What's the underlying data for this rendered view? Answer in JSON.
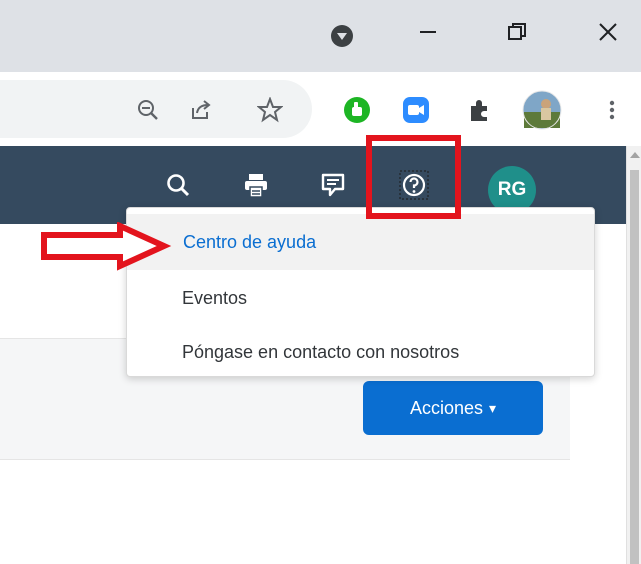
{
  "browser": {
    "window_controls": {
      "minimize_glyph": "—",
      "restore_glyph": "❐",
      "close_glyph": "✕"
    },
    "toolbar": {
      "zoom_icon": "zoom-out-icon",
      "share_icon": "share-icon",
      "bookmark_icon": "star-icon",
      "ext_1": "green-thumb-extension-icon",
      "ext_2": "zoom-extension-icon",
      "extensions_icon": "puzzle-icon",
      "profile": "profile-photo",
      "menu_icon": "kebab-menu-icon"
    }
  },
  "app_header": {
    "icons": [
      "search-icon",
      "print-icon",
      "feedback-icon",
      "help-icon"
    ],
    "avatar_initials": "RG",
    "header_color": "#354a5f"
  },
  "help_menu": {
    "items": [
      {
        "label": "Centro de ayuda",
        "highlighted": true
      },
      {
        "label": "Eventos",
        "highlighted": false
      },
      {
        "label": "Póngase en contacto con nosotros",
        "highlighted": false
      }
    ]
  },
  "page": {
    "actions_button": "Acciones",
    "actions_caret": "▾",
    "accent_color": "#0a6ed1"
  },
  "annotations": {
    "highlight_color": "#e3141d"
  }
}
